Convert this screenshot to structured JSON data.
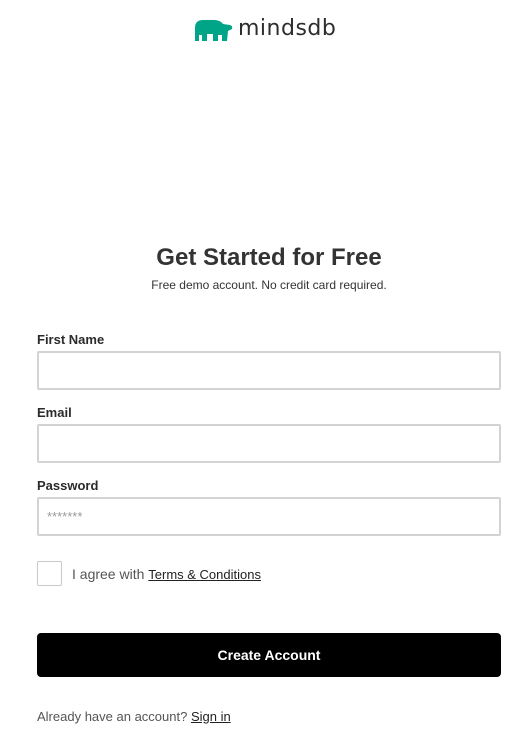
{
  "brand": {
    "name": "mindsdb",
    "logo_icon": "bear-icon",
    "logo_color": "#00a587"
  },
  "form": {
    "title": "Get Started for Free",
    "subtitle": "Free demo account. No credit card required.",
    "first_name": {
      "label": "First Name",
      "value": "",
      "placeholder": ""
    },
    "email": {
      "label": "Email",
      "value": "",
      "placeholder": ""
    },
    "password": {
      "label": "Password",
      "value": "",
      "placeholder": "*******"
    },
    "agree": {
      "text": "I agree with",
      "link_label": "Terms & Conditions",
      "checked": false
    },
    "submit_label": "Create Account",
    "signin": {
      "prompt": "Already have an account?",
      "link_label": "Sign in"
    }
  },
  "colors": {
    "button_bg": "#000000",
    "button_text": "#ffffff",
    "input_border": "#d3d3d3"
  }
}
